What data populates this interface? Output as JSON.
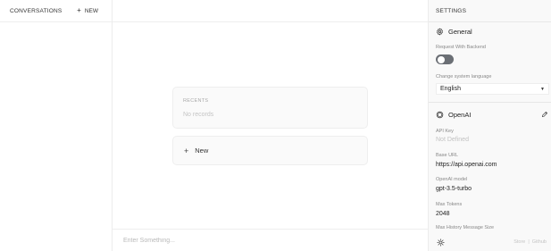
{
  "sidebar": {
    "title": "CONVERSATIONS",
    "new_icon": "plus-icon",
    "new_label": "NEW"
  },
  "main": {
    "recents_title": "RECENTS",
    "recents_empty": "No records",
    "new_card_icon": "plus-icon",
    "new_card_label": "New",
    "input_placeholder": "Enter Something..."
  },
  "settings": {
    "title": "SETTINGS",
    "general": {
      "icon": "gear-icon",
      "title": "General",
      "backend_label": "Request With Backend",
      "backend_enabled": false,
      "language_label": "Change system language",
      "language_value": "English",
      "language_caret": "▼"
    },
    "openai": {
      "icon": "openai-logo-icon",
      "title": "OpenAI",
      "edit_icon": "pencil-icon",
      "api_key_label": "API Key",
      "api_key_value": "Not Defined",
      "base_url_label": "Base URL",
      "base_url_value": "https://api.openai.com",
      "model_label": "OpenAI model",
      "model_value": "gpt-3.5-turbo",
      "max_tokens_label": "Max Tokens",
      "max_tokens_value": "2048",
      "max_history_label": "Max History Message Size"
    },
    "footer": {
      "theme_icon": "sun-icon",
      "link_store": "Store",
      "separator": "|",
      "link_github": "Github"
    }
  },
  "colors": {
    "toggle_off": "#6b6f75",
    "muted_text": "#c2c2c2",
    "panel_bg": "#f9f9f9"
  }
}
